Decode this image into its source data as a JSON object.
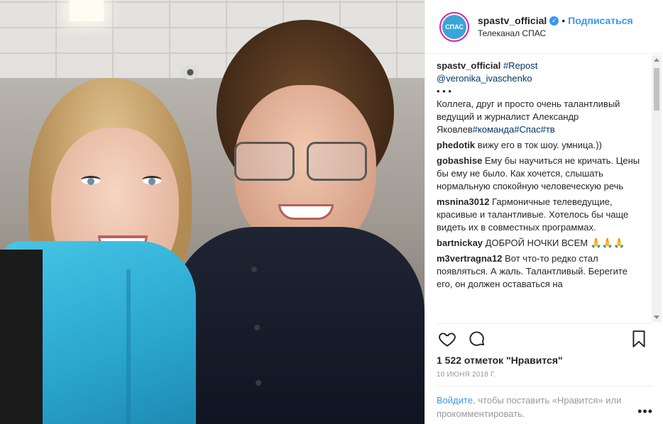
{
  "header": {
    "username": "spastv_official",
    "verified_mark": "✓",
    "separator": "•",
    "follow_label": "Подписаться",
    "subtitle": "Телеканал СПАС",
    "avatar_text": "СПАС"
  },
  "caption": {
    "username": "spastv_official",
    "tag_repost": "#Repost",
    "mention": "@veronika_ivaschenko",
    "dots": "• • •",
    "text": "Коллега, друг и просто очень талантливый ведущий и журналист Александр Яковлев",
    "tags": "#команда#Спас#тв"
  },
  "comments": [
    {
      "user": "phedotik",
      "text": "вижу его в ток шоу. умница.))"
    },
    {
      "user": "gobashise",
      "text": "Ему бы научиться не кричать. Цены бы ему не было. Как хочется, слышать нормальную спокойную человеческую речь"
    },
    {
      "user": "msnina3012",
      "text": "Гармоничные телеведущие, красивые и талантливые. Хотелось бы чаще видеть их в совместных программах."
    },
    {
      "user": "bartnickay",
      "text": "ДОБРОЙ НОЧКИ ВСЕМ 🙏🙏🙏"
    },
    {
      "user": "m3vertragna12",
      "text": "Вот что-то редко стал появляться. А жаль. Талантливый. Берегите его, он должен оставаться на"
    }
  ],
  "likes": "1 522 отметок \"Нравится\"",
  "date": "10 ИЮНЯ 2018 Г.",
  "footer": {
    "login_link": "Войдите",
    "text": ", чтобы поставить «Нравится» или прокомментировать.",
    "more": "•••"
  },
  "icons": {
    "like": "heart-icon",
    "comment": "comment-icon",
    "save": "bookmark-icon",
    "more": "more-dots-icon"
  },
  "colors": {
    "link_blue": "#3897f0",
    "hashtag": "#003569",
    "verified_blue": "#3897f0",
    "jacket": "#2aa6cf"
  }
}
